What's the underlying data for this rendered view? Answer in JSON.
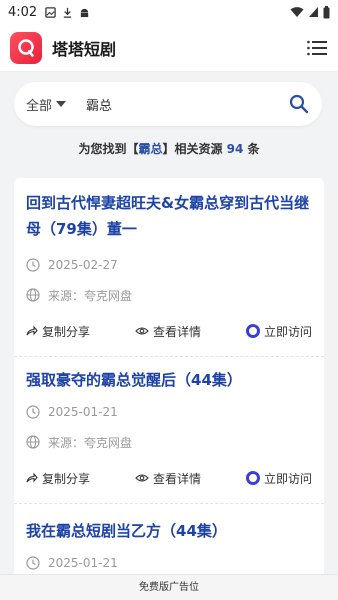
{
  "status_bar": {
    "time": "4:02"
  },
  "header": {
    "app_title": "塔塔短剧"
  },
  "search": {
    "category": "全部",
    "query": "霸总"
  },
  "summary": {
    "prefix": "为您找到【",
    "keyword": "霸总",
    "middle": "】相关资源 ",
    "count": "94",
    "suffix": " 条"
  },
  "results": [
    {
      "title": "回到古代悍妻超旺夫&女霸总穿到古代当继母（79集）董一",
      "date": "2025-02-27",
      "source": "来源：夸克网盘",
      "share": "复制分享",
      "details": "查看详情",
      "visit": "立即访问"
    },
    {
      "title": "强取豪夺的霸总觉醒后（44集）",
      "date": "2025-01-21",
      "source": "来源：夸克网盘",
      "share": "复制分享",
      "details": "查看详情",
      "visit": "立即访问"
    },
    {
      "title": "我在霸总短剧当乙方（44集）",
      "date": "2025-01-21"
    }
  ],
  "ad": {
    "label": "免费版广告位"
  },
  "colors": {
    "accent": "#1e43a8",
    "brand": "#e6223b",
    "visit": "#3b3fd6"
  }
}
